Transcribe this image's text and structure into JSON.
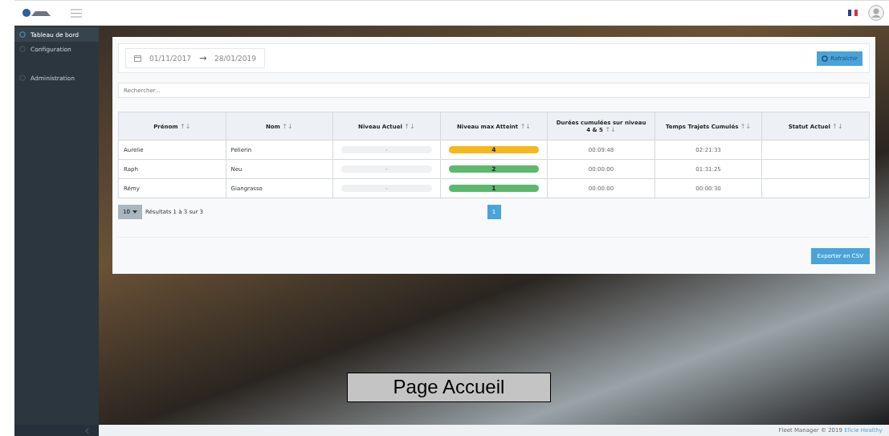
{
  "sidebar": {
    "items": [
      {
        "label": "Tableau de bord",
        "selected": true
      },
      {
        "label": "Configuration",
        "selected": false
      },
      {
        "label": "Administration",
        "selected": false
      }
    ]
  },
  "date_range": {
    "start": "01/11/2017",
    "arrow": "→",
    "end": "28/01/2019"
  },
  "refresh_button": "Rafraîchir",
  "search": {
    "placeholder": "Rechercher..."
  },
  "table": {
    "columns": [
      {
        "label": "Prénom",
        "sort": "↑↓"
      },
      {
        "label": "Nom",
        "sort": "↑↓"
      },
      {
        "label": "Niveau Actuel",
        "sort": "↑↓"
      },
      {
        "label": "Niveau max Atteint",
        "sort": "↑↓"
      },
      {
        "label": "Durées cumulées sur niveau 4 & 5",
        "sort": "↑↓"
      },
      {
        "label": "Temps Trajets Cumulés",
        "sort": "↑↓"
      },
      {
        "label": "Statut Actuel",
        "sort": "↑↓"
      }
    ],
    "rows": [
      {
        "prenom": "Aurelie",
        "nom": "Pellerin",
        "niveau_actuel": "-",
        "niveau_max": {
          "value": "4",
          "color": "#f5b71c"
        },
        "durees": "00:09:48",
        "temps": "02:21:33"
      },
      {
        "prenom": "Raph",
        "nom": "Neu",
        "niveau_actuel": "-",
        "niveau_max": {
          "value": "2",
          "color": "#5cb86a"
        },
        "durees": "00:00:00",
        "temps": "01:31:25"
      },
      {
        "prenom": "Rémy",
        "nom": "Giangrasso",
        "niveau_actuel": "-",
        "niveau_max": {
          "value": "1",
          "color": "#5cb86a"
        },
        "durees": "00:00:00",
        "temps": "00:00:30"
      }
    ]
  },
  "page_size": "10",
  "results": "Résultats 1 à 3 sur 3",
  "pages": [
    {
      "label": "1",
      "selected": true
    }
  ],
  "export_button": "Exporter en CSV",
  "caption": "Page Accueil",
  "footer": {
    "text": "Fleet Manager © 2019",
    "link": "Ellcie Healthy"
  }
}
